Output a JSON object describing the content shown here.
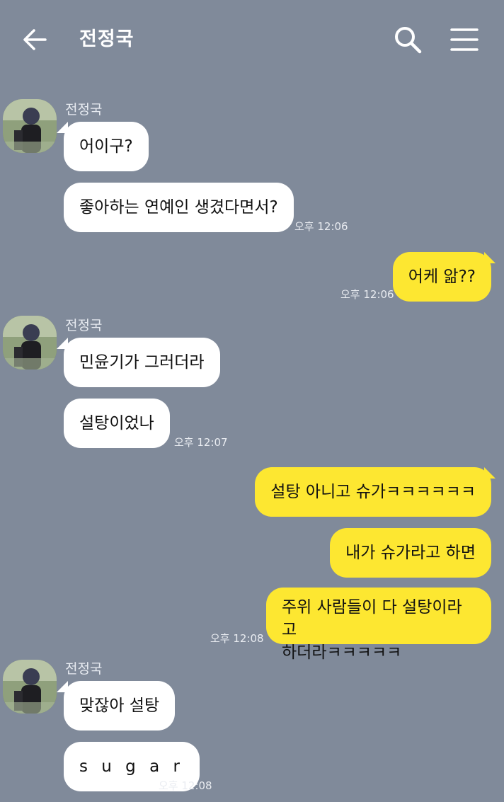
{
  "header": {
    "title": "전정국",
    "back_icon": "arrow-left-icon",
    "search_icon": "search-icon",
    "menu_icon": "hamburger-menu-icon"
  },
  "colors": {
    "background": "#808a9a",
    "incoming_bubble": "#ffffff",
    "outgoing_bubble": "#fde731"
  },
  "messages": {
    "group1": {
      "sender": "전정국",
      "m1": "어이구?",
      "m2": "좋아하는 연예인 생겼다면서?",
      "time": "오후 12:06"
    },
    "group2": {
      "m1": "어케 앎??",
      "time": "오후 12:06"
    },
    "group3": {
      "sender": "전정국",
      "m1": "민윤기가 그러더라",
      "m2": "설탕이었나",
      "time": "오후 12:07"
    },
    "group4": {
      "m1": "설탕 아니고 슈가ㅋㅋㅋㅋㅋㅋ",
      "m2": "내가 슈가라고 하면",
      "m3_line1": "주위 사람들이 다 설탕이라고",
      "m3_line2": "하더라ㅋㅋㅋㅋㅋ",
      "time": "오후 12:08"
    },
    "group5": {
      "sender": "전정국",
      "m1": "맞잖아 설탕",
      "m2": "s u g a r",
      "time": "오후 12:08"
    }
  }
}
